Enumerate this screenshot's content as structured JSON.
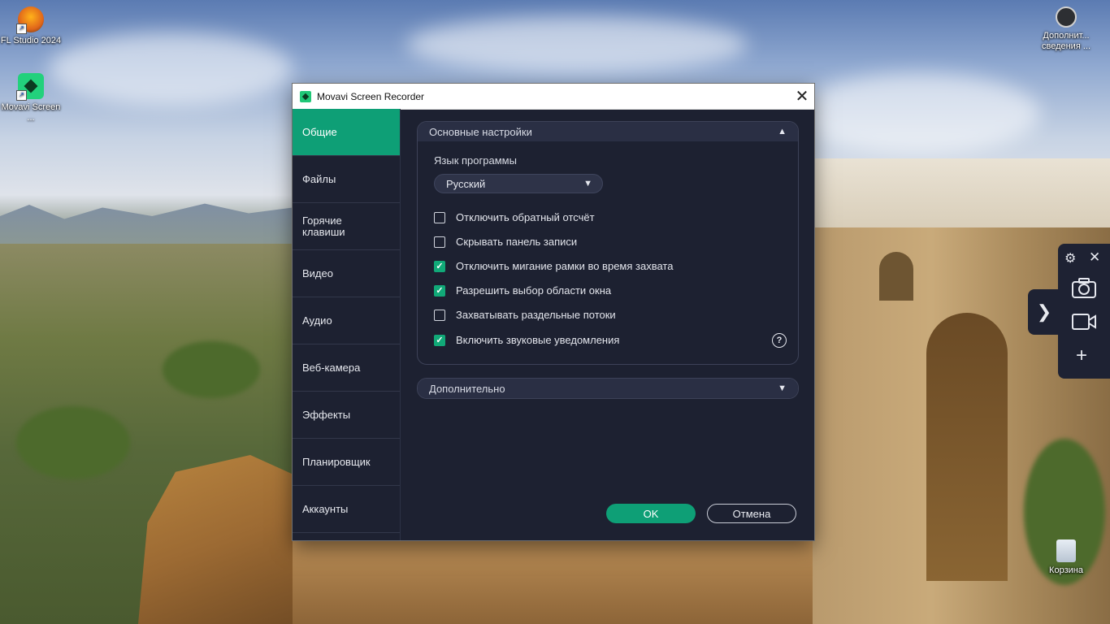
{
  "desktop": {
    "icons": [
      {
        "label": "FL Studio 2024"
      },
      {
        "label": "Movavi Screen ..."
      },
      {
        "label": "Дополнит... сведения ..."
      },
      {
        "label": "Корзина"
      }
    ]
  },
  "window": {
    "title": "Movavi Screen Recorder",
    "close_glyph": "✕"
  },
  "sidebar": {
    "items": [
      {
        "label": "Общие",
        "active": true
      },
      {
        "label": "Файлы"
      },
      {
        "label": "Горячие клавиши"
      },
      {
        "label": "Видео"
      },
      {
        "label": "Аудио"
      },
      {
        "label": "Веб-камера"
      },
      {
        "label": "Эффекты"
      },
      {
        "label": "Планировщик"
      },
      {
        "label": "Аккаунты"
      }
    ]
  },
  "main": {
    "basic_section": {
      "title": "Основные настройки",
      "language_label": "Язык программы",
      "language_value": "Русский",
      "options": [
        {
          "label": "Отключить обратный отсчёт",
          "checked": false
        },
        {
          "label": "Скрывать панель записи",
          "checked": false
        },
        {
          "label": "Отключить мигание рамки во время захвата",
          "checked": true
        },
        {
          "label": "Разрешить выбор области окна",
          "checked": true
        },
        {
          "label": "Захватывать раздельные потоки",
          "checked": false
        },
        {
          "label": "Включить звуковые уведомления",
          "checked": true
        }
      ],
      "help_glyph": "?"
    },
    "advanced_section": {
      "title": "Дополнительно"
    }
  },
  "buttons": {
    "ok": "OK",
    "cancel": "Отмена"
  },
  "colors": {
    "accent": "#0e9f76",
    "window_bg": "#1d2131",
    "header_bg": "#2a2f44"
  }
}
